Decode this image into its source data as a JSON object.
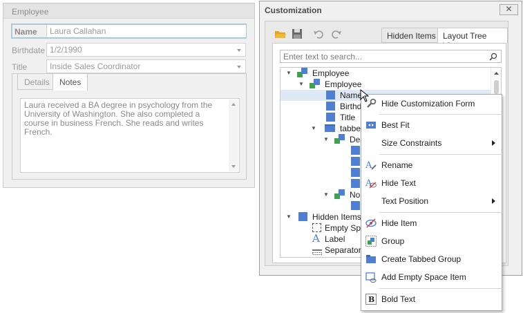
{
  "employee_panel": {
    "title": "Employee",
    "fields": {
      "name_label": "Name",
      "name_value": "Laura Callahan",
      "birthdate_label": "Birthdate",
      "birthdate_value": "1/2/1990",
      "title_label": "Title",
      "title_value": "Inside Sales Coordinator"
    },
    "tabs": [
      "Details",
      "Notes"
    ],
    "active_tab": "Notes",
    "notes_text": "Laura received a BA degree in psychology from the University of Washington. She also completed a course in business French. She reads and writes French."
  },
  "customization": {
    "title": "Customization",
    "close_glyph": "✕",
    "tabs": {
      "hidden_items": "Hidden Items",
      "layout_tree_view": "Layout Tree View"
    },
    "active_tab": "Layout Tree View",
    "toolbar_icons": [
      "open-folder-icon",
      "save-icon",
      "undo-icon",
      "redo-icon"
    ],
    "search_placeholder": "Enter text to search...",
    "tree": [
      {
        "label": "Employee",
        "level": 0,
        "icon": "group-icon",
        "expanded": true
      },
      {
        "label": "Employee",
        "level": 1,
        "icon": "group-icon",
        "expanded": true
      },
      {
        "label": "Name",
        "level": 2,
        "icon": "item-icon",
        "selected": true
      },
      {
        "label": "Birthdate",
        "level": 2,
        "icon": "item-icon"
      },
      {
        "label": "Title",
        "level": 2,
        "icon": "item-icon"
      },
      {
        "label": "tabbed",
        "level": 2,
        "icon": "tabbed-group-icon",
        "expanded": true
      },
      {
        "label": "De",
        "level": 3,
        "icon": "group-icon",
        "expanded": true
      },
      {
        "label": "No",
        "level": 3,
        "icon": "group-icon",
        "expanded": true
      },
      {
        "label": "Hidden Items",
        "level": 0,
        "icon": "item-icon",
        "expanded": true
      },
      {
        "label": "Empty Spa",
        "level": 1,
        "icon": "empty-space-icon"
      },
      {
        "label": "Label",
        "level": 1,
        "icon": "label-icon"
      },
      {
        "label": "Separator",
        "level": 1,
        "icon": "separator-icon"
      }
    ]
  },
  "context_menu": {
    "items": [
      {
        "label": "Hide Customization Form",
        "icon": "wrench-icon"
      },
      {
        "label": "Best Fit",
        "icon": "best-fit-icon"
      },
      {
        "label": "Size Constraints",
        "submenu": true
      },
      {
        "label": "Rename",
        "icon": "rename-icon"
      },
      {
        "label": "Hide Text",
        "icon": "hide-text-icon"
      },
      {
        "label": "Text Position",
        "submenu": true
      },
      {
        "label": "Hide Item",
        "icon": "hide-item-icon"
      },
      {
        "label": "Group",
        "icon": "group-icon"
      },
      {
        "label": "Create Tabbed Group",
        "icon": "tabbed-group-icon"
      },
      {
        "label": "Add Empty Space Item",
        "icon": "add-empty-space-icon"
      },
      {
        "label": "Bold Text",
        "icon": "bold-icon"
      }
    ]
  },
  "colors": {
    "accent_blue": "#4f7fd2",
    "accent_green": "#3fa34d",
    "selection": "#dfe9f5",
    "focus_border": "#a9c8d8"
  }
}
